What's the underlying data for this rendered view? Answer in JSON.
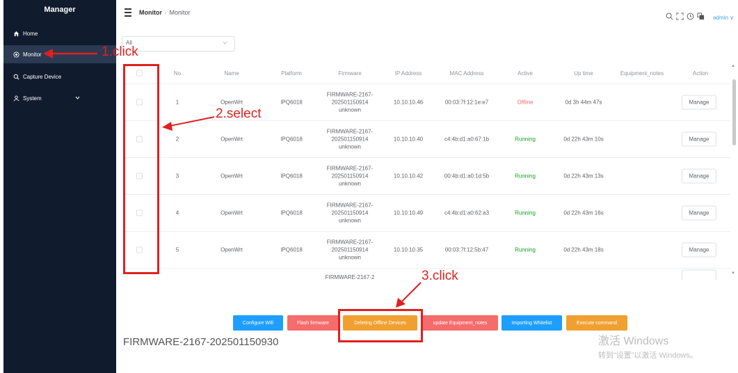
{
  "sidebar": {
    "title": "Manager",
    "items": [
      {
        "label": "Home",
        "icon": "home-icon"
      },
      {
        "label": "Monitor",
        "icon": "monitor-icon"
      },
      {
        "label": "Capture Device",
        "icon": "search-icon"
      },
      {
        "label": "System",
        "icon": "user-icon"
      }
    ]
  },
  "header": {
    "breadcrumb_root": "Monitor",
    "breadcrumb_sep": "/",
    "breadcrumb_current": "Monitor",
    "user": "admin",
    "user_chevron": "∨"
  },
  "filter": {
    "value": "All"
  },
  "table": {
    "columns": [
      "No",
      "Name",
      "Platform",
      "Firmware",
      "IP Address",
      "MAC Address",
      "Active",
      "Up time",
      "Equipment_notes",
      "Action"
    ],
    "rows": [
      {
        "no": "1",
        "name": "OpenWrt",
        "platform": "IPQ6018",
        "firmware": "FIRMWARE-2167-202501150914 unknown",
        "ip": "10.10.10.46",
        "mac": "00:03:7f:12:1e:e7",
        "active": "Offline",
        "uptime": "0d 3h 44m 47s",
        "notes": "",
        "action": "Manage"
      },
      {
        "no": "2",
        "name": "OpenWrt",
        "platform": "IPQ6018",
        "firmware": "FIRMWARE-2167-202501150914 unknown",
        "ip": "10.10.10.40",
        "mac": "c4:4b:d1:a0:67:1b",
        "active": "Running",
        "uptime": "0d 22h 43m 10s",
        "notes": "",
        "action": "Manage"
      },
      {
        "no": "3",
        "name": "OpenWrt",
        "platform": "IPQ6018",
        "firmware": "FIRMWARE-2167-202501150914 unknown",
        "ip": "10.10.10.42",
        "mac": "00:4b:d1:a0:1d:5b",
        "active": "Running",
        "uptime": "0d 22h 43m 13s",
        "notes": "",
        "action": "Manage"
      },
      {
        "no": "4",
        "name": "OpenWrt",
        "platform": "IPQ6018",
        "firmware": "FIRMWARE-2167-202501150914 unknown",
        "ip": "10.10.10.49",
        "mac": "c4:4b:d1:a0:62:a3",
        "active": "Running",
        "uptime": "0d 22h 43m 16s",
        "notes": "",
        "action": "Manage"
      },
      {
        "no": "5",
        "name": "OpenWrt",
        "platform": "IPQ6018",
        "firmware": "FIRMWARE-2167-202501150914 unknown",
        "ip": "10.10.10.35",
        "mac": "00:03:7f:12:5b:47",
        "active": "Running",
        "uptime": "0d 22h 43m 18s",
        "notes": "",
        "action": "Manage"
      }
    ],
    "partial_row_firmware": "FIRMWARE-2167-2"
  },
  "actions": [
    {
      "label": "Configure Wifi",
      "color": "#1e9fff"
    },
    {
      "label": "Flash firmware",
      "color": "#f56c6c"
    },
    {
      "label": "Deleting Offline Devices",
      "color": "#f0a030"
    },
    {
      "label": "update Equipment_notes",
      "color": "#f56c6c"
    },
    {
      "label": "Importing Whitelist",
      "color": "#1e9fff"
    },
    {
      "label": "Execute command",
      "color": "#f0a030"
    }
  ],
  "footer_firmware": "FIRMWARE-2167-202501150930",
  "watermark": {
    "line1": "激活 Windows",
    "line2": "转到“设置”以激活 Windows。"
  },
  "annotations": {
    "step1": "1.click",
    "step2": "2.select",
    "step3": "3.click",
    "color": "#e02020"
  }
}
